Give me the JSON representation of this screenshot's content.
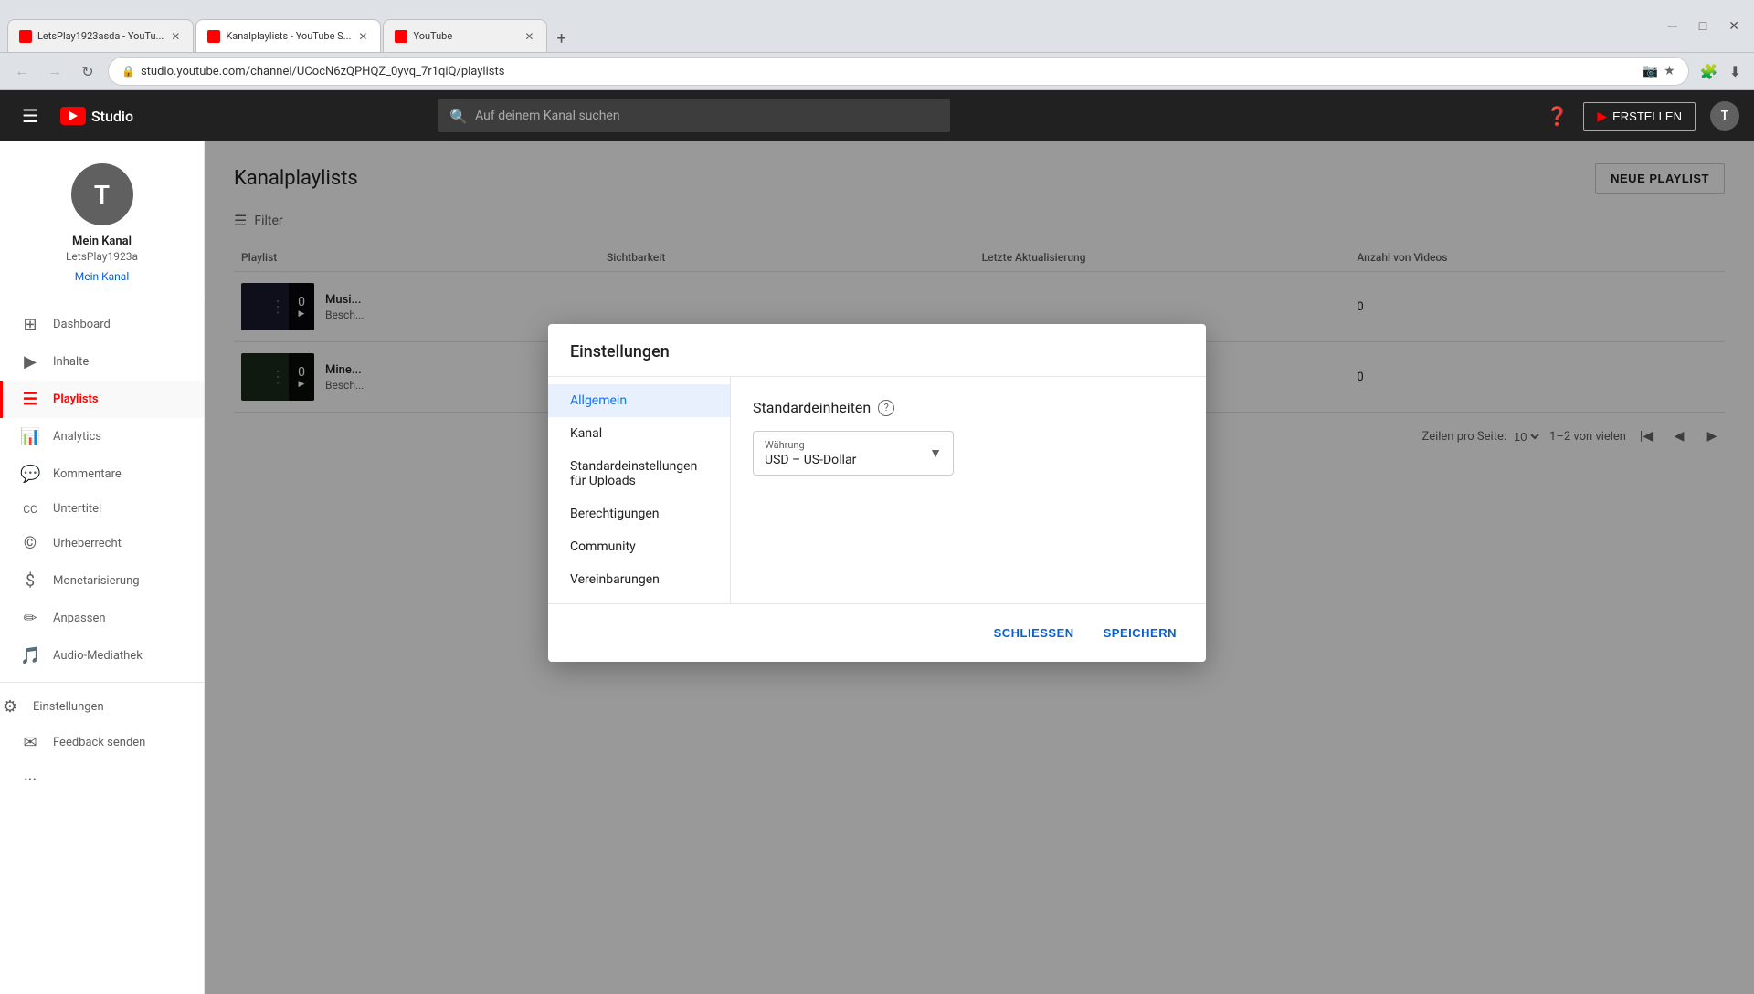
{
  "browser": {
    "tabs": [
      {
        "id": "tab1",
        "title": "LetsPlay1923asda - YouTu...",
        "favicon": "yt",
        "active": false
      },
      {
        "id": "tab2",
        "title": "Kanalplaylists - YouTube S...",
        "favicon": "yt-studio",
        "active": true
      },
      {
        "id": "tab3",
        "title": "YouTube",
        "favicon": "yt",
        "active": false
      }
    ],
    "address": "studio.youtube.com/channel/UCocN6zQPHQZ_0yvq_7r1qiQ/playlists",
    "new_tab_label": "+",
    "back_label": "←",
    "forward_label": "→",
    "refresh_label": "↻",
    "home_label": "⌂"
  },
  "topnav": {
    "studio_label": "Studio",
    "search_placeholder": "Auf deinem Kanal suchen",
    "create_label": "ERSTELLEN",
    "help_label": "?",
    "avatar_letter": "T"
  },
  "sidebar": {
    "channel_name": "Mein Kanal",
    "channel_handle": "LetsPlay1923a",
    "avatar_letter": "T",
    "my_channel_label": "Mein Kanal",
    "items": [
      {
        "id": "dashboard",
        "label": "Dashboard",
        "icon": "⊞"
      },
      {
        "id": "content",
        "label": "Inhalte",
        "icon": "▶"
      },
      {
        "id": "playlists",
        "label": "Playlists",
        "icon": "☰"
      },
      {
        "id": "analytics",
        "label": "Analytics",
        "icon": "📊"
      },
      {
        "id": "comments",
        "label": "Kommentare",
        "icon": "💬"
      },
      {
        "id": "subtitles",
        "label": "Untertitel",
        "icon": "CC"
      },
      {
        "id": "copyright",
        "label": "Urheberrecht",
        "icon": "©"
      },
      {
        "id": "monetization",
        "label": "Monetarisierung",
        "icon": "$"
      },
      {
        "id": "customize",
        "label": "Anpassen",
        "icon": "✏"
      },
      {
        "id": "audio",
        "label": "Audio-Mediathek",
        "icon": "🎵"
      }
    ],
    "bottom_items": [
      {
        "id": "settings",
        "label": "Einstellungen",
        "icon": "⚙"
      },
      {
        "id": "feedback",
        "label": "Feedback senden",
        "icon": "✉"
      }
    ],
    "more_label": "···"
  },
  "page": {
    "title": "Kanalplaylists",
    "new_playlist_label": "NEUE PLAYLIST",
    "filter_label": "Filter",
    "table_headers": [
      "Playlist",
      "",
      "Sichtbarkeit",
      "Letzte Aktualisierung",
      "Anzahl von Videos"
    ],
    "rows": [
      {
        "name": "Musi...",
        "description": "Besch...",
        "count": "0",
        "visibility": "",
        "updated": "",
        "videos": "0"
      },
      {
        "name": "Mine...",
        "description": "Besch...",
        "count": "0",
        "visibility": "",
        "updated": "",
        "videos": "0"
      }
    ],
    "pagination": {
      "rows_label": "Zeilen pro Seite:",
      "rows_value": "10",
      "range_label": "1–2 von vielen",
      "first_label": "|◀",
      "prev_label": "◀",
      "next_label": "▶"
    }
  },
  "dialog": {
    "title": "Einstellungen",
    "nav_items": [
      {
        "id": "allgemein",
        "label": "Allgemein",
        "active": true
      },
      {
        "id": "kanal",
        "label": "Kanal",
        "active": false
      },
      {
        "id": "uploads",
        "label": "Standardeinstellungen für Uploads",
        "active": false
      },
      {
        "id": "permissions",
        "label": "Berechtigungen",
        "active": false
      },
      {
        "id": "community",
        "label": "Community",
        "active": false
      },
      {
        "id": "agreements",
        "label": "Vereinbarungen",
        "active": false
      }
    ],
    "section_title": "Standardeinheiten",
    "currency_label": "Währung",
    "currency_value": "USD – US-Dollar",
    "info_icon": "?",
    "close_label": "SCHLIESSEN",
    "save_label": "SPEICHERN"
  }
}
